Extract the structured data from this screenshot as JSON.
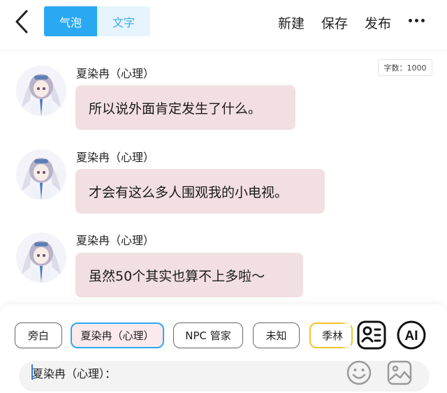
{
  "header": {
    "back_label": "<",
    "tabs": [
      {
        "label": "气泡",
        "active": true
      },
      {
        "label": "文字",
        "active": false
      }
    ],
    "actions": {
      "new": "新建",
      "save": "保存",
      "publish": "发布"
    },
    "more_icon": "more-dots-icon"
  },
  "word_count": "字数：1000",
  "messages": [
    {
      "name": "夏染冉（心理）",
      "text": "所以说外面肯定发生了什么。"
    },
    {
      "name": "夏染冉（心理）",
      "text": "才会有这么多人围观我的小电视。"
    },
    {
      "name": "夏染冉（心理）",
      "text": "虽然50个其实也算不上多啦～"
    }
  ],
  "characters": [
    {
      "label": "旁白",
      "selected": false
    },
    {
      "label": "夏染冉（心理）",
      "selected": true
    },
    {
      "label": "NPC 管家",
      "selected": false
    },
    {
      "label": "未知",
      "selected": false
    },
    {
      "label": "季林",
      "selected": false
    }
  ],
  "tool_icons": {
    "character_card": "character-card-icon",
    "ai": "AI"
  },
  "input": {
    "value": "夏染冉（心理）："
  },
  "colors": {
    "accent": "#2aa9f2",
    "bubble": "#f2dfe1",
    "selected_chip_bg": "#fbe9ec",
    "gold_chip_border": "#f2c22e"
  }
}
